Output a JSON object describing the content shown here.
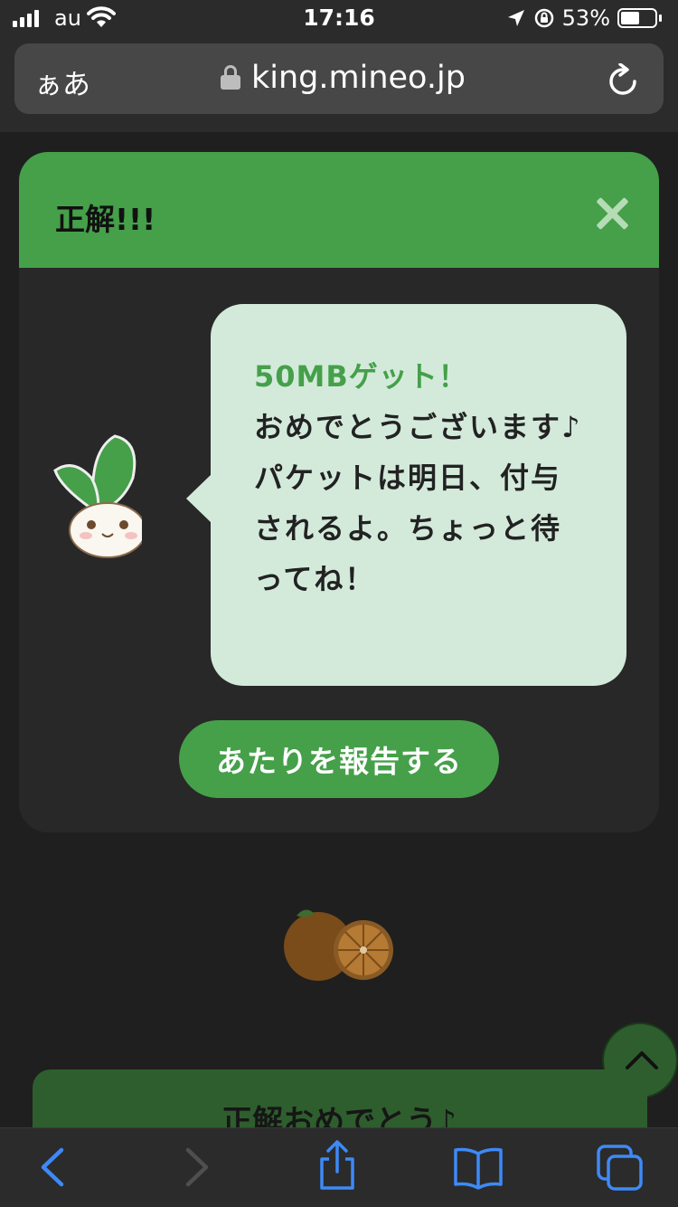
{
  "status_bar": {
    "carrier": "au",
    "time": "17:16",
    "battery_percent": "53%",
    "battery_level": 0.53,
    "icons": [
      "signal-icon",
      "wifi-icon",
      "location-icon",
      "orientation-lock-icon",
      "battery-icon"
    ]
  },
  "browser": {
    "aa_label": "ぁあ",
    "url": "king.mineo.jp",
    "icons": [
      "lock-icon",
      "reload-icon"
    ]
  },
  "modal": {
    "title": "正解!!!",
    "message_highlight": "50MBゲット！",
    "message_body": "おめでとうございます♪パケットは明日、付与されるよ。ちょっと待ってね！",
    "report_button": "あたりを報告する",
    "colors": {
      "header": "#45a049",
      "bubble": "#d3eadb",
      "accent": "#45a049"
    }
  },
  "page": {
    "bottom_card_title": "正解おめでとう♪"
  },
  "toolbar": {
    "icons": [
      "back-icon",
      "forward-icon",
      "share-icon",
      "bookmarks-icon",
      "tabs-icon"
    ],
    "accent": "#3d8af7"
  }
}
